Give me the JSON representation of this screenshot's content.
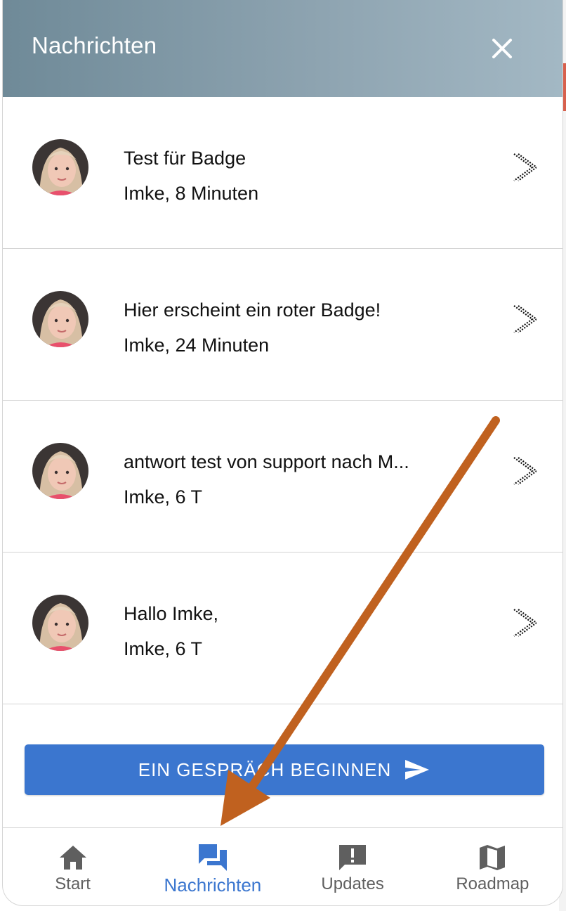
{
  "header": {
    "title": "Nachrichten"
  },
  "conversations": [
    {
      "title": "Test für Badge",
      "meta": "Imke, 8 Minuten"
    },
    {
      "title": "Hier erscheint ein roter Badge!",
      "meta": "Imke, 24 Minuten"
    },
    {
      "title": "antwort test von support nach M...",
      "meta": "Imke, 6 T"
    },
    {
      "title": "Hallo Imke,",
      "meta": "Imke, 6 T"
    }
  ],
  "cta": {
    "label": "EIN GESPRÄCH BEGINNEN",
    "icon": "send-icon"
  },
  "nav": [
    {
      "label": "Start",
      "icon": "home-icon",
      "active": false
    },
    {
      "label": "Nachrichten",
      "icon": "chat-bubbles-icon",
      "active": true
    },
    {
      "label": "Updates",
      "icon": "feedback-exclamation-icon",
      "active": false
    },
    {
      "label": "Roadmap",
      "icon": "map-icon",
      "active": false
    }
  ],
  "colors": {
    "accent": "#3b76cf",
    "header_start": "#6f8a98",
    "header_end": "#a3b8c4",
    "annotation_arrow": "#c0611f"
  }
}
